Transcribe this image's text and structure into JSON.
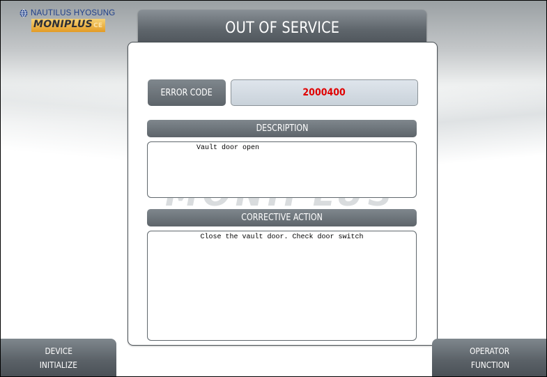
{
  "brand": {
    "company": "NAUTILUS HYOSUNG",
    "product": "MONIPLUS",
    "product_suffix": "CE",
    "watermark": "MONIPLUS"
  },
  "header": {
    "title": "OUT OF SERVICE"
  },
  "error": {
    "code_label": "ERROR CODE",
    "code_value": "2000400",
    "code_value_color": "#e00000"
  },
  "description": {
    "header": "DESCRIPTION",
    "text": "Vault door open"
  },
  "corrective_action": {
    "header": "CORRECTIVE ACTION",
    "text": "Close the vault door. Check door switch"
  },
  "buttons": {
    "device_initialize": {
      "line1": "DEVICE",
      "line2": "INITIALIZE"
    },
    "operator_function": {
      "line1": "OPERATOR",
      "line2": "FUNCTION"
    }
  },
  "colors": {
    "plate": "#5f666c",
    "accent_error": "#e00000",
    "logo_blue": "#1f3f8a",
    "logo_orange": "#e39b26"
  }
}
